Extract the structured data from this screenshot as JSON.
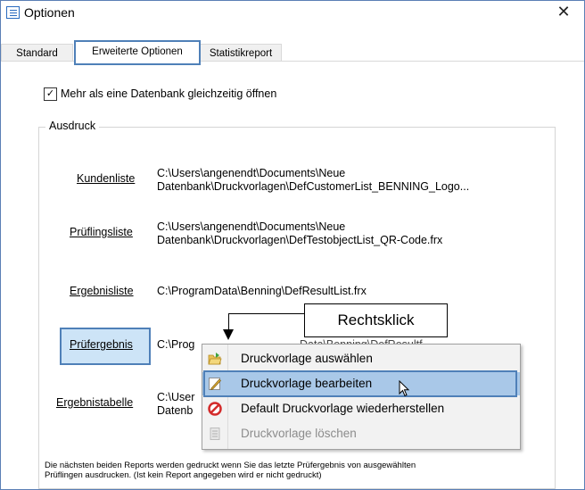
{
  "window": {
    "title": "Optionen",
    "close_glyph": "✕"
  },
  "tabs": [
    {
      "label": "Standard"
    },
    {
      "label": "Erweiterte Optionen",
      "active": true
    },
    {
      "label": "Statistikreport"
    }
  ],
  "options": {
    "multi_db_checkbox": {
      "label": "Mehr als eine Datenbank gleichzeitig öffnen",
      "checked": true,
      "glyph": "✓"
    }
  },
  "ausdruck": {
    "group_label": "Ausdruck",
    "rows": [
      {
        "link": "Kundenliste",
        "path_line1": "C:\\Users\\angenendt\\Documents\\Neue",
        "path_line2": "Datenbank\\Druckvorlagen\\DefCustomerList_BENNING_Logo..."
      },
      {
        "link": "Prüflingsliste",
        "path_line1": "C:\\Users\\angenendt\\Documents\\Neue",
        "path_line2": "Datenbank\\Druckvorlagen\\DefTestobjectList_QR-Code.frx"
      },
      {
        "link": "Ergebnisliste",
        "path_line1": "C:\\ProgramData\\Benning\\DefResultList.frx"
      },
      {
        "link": "Prüfergebnis",
        "path_line1": "C:\\Prog",
        "path_partial": "Data\\Benning\\DefResultf..."
      },
      {
        "link": "Ergebnistabelle",
        "path_line1": "C:\\User",
        "path_line2": "Datenb"
      }
    ],
    "footer_line1": "Die nächsten beiden Reports werden gedruckt wenn Sie das letzte Prüfergebnis von ausgewählten",
    "footer_line2": "Prüflingen ausdrucken. (Ist kein Report angegeben wird er nicht gedruckt)"
  },
  "callout": {
    "text": "Rechtsklick"
  },
  "context_menu": {
    "items": [
      {
        "label": "Druckvorlage auswählen",
        "icon": "folder-open-icon",
        "state": "normal"
      },
      {
        "label": "Druckvorlage bearbeiten",
        "icon": "pencil-edit-icon",
        "state": "highlighted"
      },
      {
        "label": "Default Druckvorlage wiederherstellen",
        "icon": "restore-prohibited-icon",
        "state": "normal"
      },
      {
        "label": "Druckvorlage löschen",
        "icon": "delete-document-icon",
        "state": "disabled"
      }
    ]
  },
  "colors": {
    "accent": "#4f80b8",
    "highlight_bg": "#cde4f7",
    "menu_selected": "#a9c8e8",
    "disabled_text": "#8c8c8c"
  }
}
